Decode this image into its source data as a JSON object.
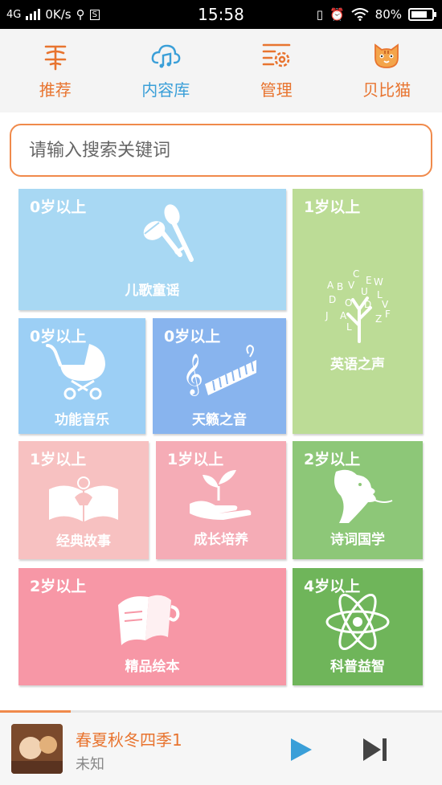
{
  "status_bar": {
    "network": "4G",
    "speed": "0K/s",
    "time": "15:58",
    "battery": "80%",
    "battery_level": 0.8
  },
  "nav": [
    {
      "label": "推荐",
      "icon": "recommend-icon",
      "color": "#e8742f"
    },
    {
      "label": "内容库",
      "icon": "cloud-music-icon",
      "color": "#3a9fd8"
    },
    {
      "label": "管理",
      "icon": "settings-icon",
      "color": "#e8742f"
    },
    {
      "label": "贝比猫",
      "icon": "cat-icon",
      "color": "#e8742f"
    }
  ],
  "search": {
    "placeholder": "请输入搜索关键词"
  },
  "tiles": [
    {
      "age": "0岁以上",
      "name": "儿歌童谣",
      "icon": "maracas-icon",
      "color": "#a8d8f3"
    },
    {
      "age": "1岁以上",
      "name": "英语之声",
      "icon": "alphabet-tree-icon",
      "color": "#bcdc96"
    },
    {
      "age": "0岁以上",
      "name": "功能音乐",
      "icon": "stroller-icon",
      "color": "#9ccff5"
    },
    {
      "age": "0岁以上",
      "name": "天籁之音",
      "icon": "piano-treble-icon",
      "color": "#88b4ee"
    },
    {
      "age": "1岁以上",
      "name": "经典故事",
      "icon": "open-book-icon",
      "color": "#f7c1c1"
    },
    {
      "age": "1岁以上",
      "name": "成长培养",
      "icon": "sprout-hand-icon",
      "color": "#f5acb6"
    },
    {
      "age": "2岁以上",
      "name": "诗词国学",
      "icon": "scholar-icon",
      "color": "#8dc778"
    },
    {
      "age": "2岁以上",
      "name": "精品绘本",
      "icon": "picture-book-icon",
      "color": "#f797a6"
    },
    {
      "age": "4岁以上",
      "name": "科普益智",
      "icon": "atom-icon",
      "color": "#6fb55a"
    }
  ],
  "player": {
    "title": "春夏秋冬四季1",
    "artist": "未知",
    "progress": 0.16,
    "accent": "#e8742f",
    "play_color": "#3a9fd8"
  }
}
